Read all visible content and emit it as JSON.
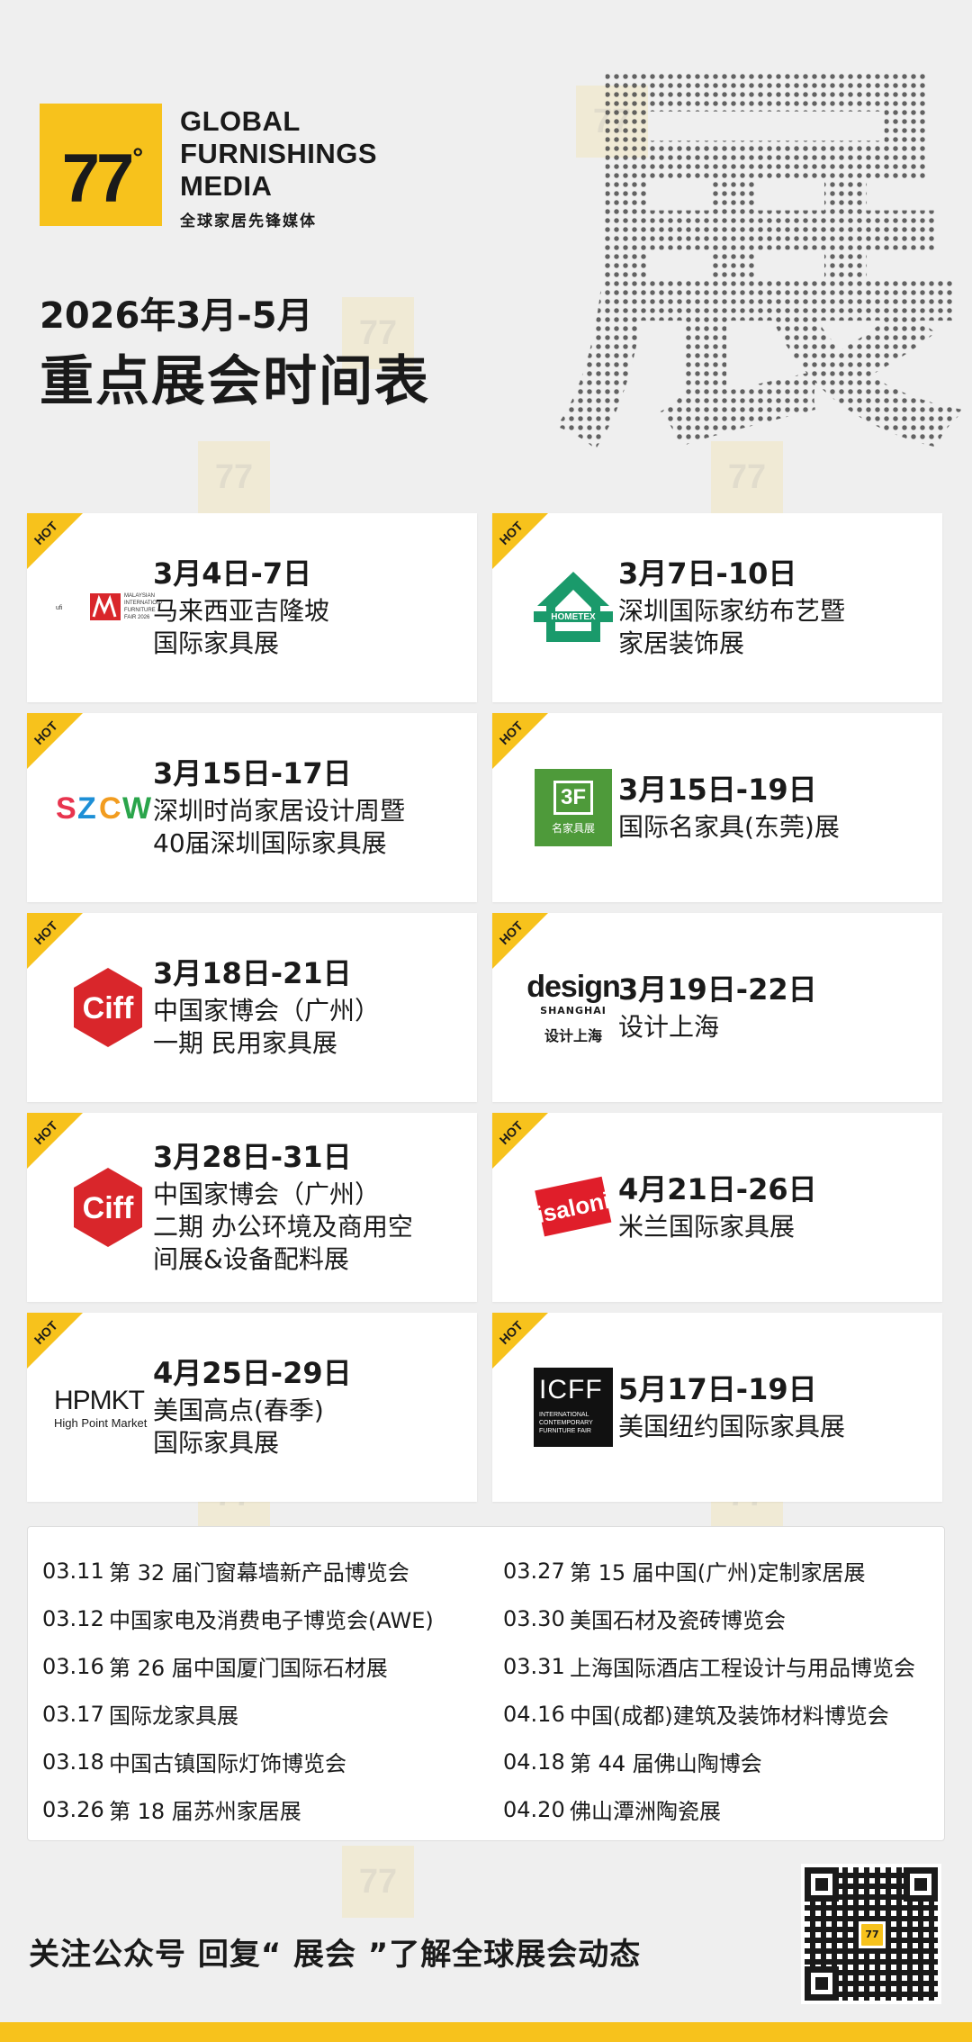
{
  "brand": {
    "logo_number": "77",
    "logo_degree": "°",
    "name_lines": [
      "GLOBAL",
      "FURNISHINGS",
      "MEDIA"
    ],
    "tagline": "全球家居先锋媒体",
    "accent_color": "#f7c21c"
  },
  "background_character": "展",
  "headline": {
    "date_range": "2026年3月-5月",
    "title": "重点展会时间表"
  },
  "hot_label": "HOT",
  "featured": [
    {
      "date": "3月4日-7日",
      "name_lines": [
        "马来西亚吉隆坡",
        "国际家具展"
      ],
      "logo": "miff-logo",
      "logo_text": "MALAYSIAN INTERNATIONAL FURNITURE FAIR 2026"
    },
    {
      "date": "3月7日-10日",
      "name_lines": [
        "深圳国际家纺布艺暨",
        "家居装饰展"
      ],
      "logo": "hometex-logo",
      "logo_text": "HOMETEX"
    },
    {
      "date": "3月15日-17日",
      "name_lines": [
        "深圳时尚家居设计周暨",
        "40届深圳国际家具展"
      ],
      "logo": "szcw-logo",
      "logo_text": "SZCW"
    },
    {
      "date": "3月15日-19日",
      "name_lines": [
        "国际名家具(东莞)展"
      ],
      "logo": "3f-logo",
      "logo_text": "3F",
      "logo_subtext": "名家具展"
    },
    {
      "date": "3月18日-21日",
      "name_lines": [
        "中国家博会（广州）",
        "一期 民用家具展"
      ],
      "logo": "ciff-logo",
      "logo_text": "CIFF"
    },
    {
      "date": "3月19日-22日",
      "name_lines": [
        "设计上海"
      ],
      "logo": "design-shanghai-logo",
      "logo_text": "design",
      "logo_subtext": "SHANGHAI",
      "logo_cn": "设计上海"
    },
    {
      "date": "3月28日-31日",
      "name_lines": [
        "中国家博会（广州）",
        "二期 办公环境及商用空",
        "间展&设备配料展"
      ],
      "logo": "ciff-logo",
      "logo_text": "CIFF"
    },
    {
      "date": "4月21日-26日",
      "name_lines": [
        "米兰国际家具展"
      ],
      "logo": "isaloni-logo",
      "logo_text": "isaloni"
    },
    {
      "date": "4月25日-29日",
      "name_lines": [
        "美国高点(春季)",
        "国际家具展"
      ],
      "logo": "hpmkt-logo",
      "logo_text": "HPMKT",
      "logo_subtext": "High Point Market"
    },
    {
      "date": "5月17日-19日",
      "name_lines": [
        "美国纽约国际家具展"
      ],
      "logo": "icff-logo",
      "logo_text": "ICFF",
      "logo_subtext": "INTERNATIONAL CONTEMPORARY FURNITURE FAIR"
    }
  ],
  "other_events": {
    "left": [
      {
        "date": "03.11",
        "name": "第 32 届门窗幕墙新产品博览会"
      },
      {
        "date": "03.12",
        "name": "中国家电及消费电子博览会(AWE)"
      },
      {
        "date": "03.16",
        "name": "第 26 届中国厦门国际石材展"
      },
      {
        "date": "03.17",
        "name": "国际龙家具展"
      },
      {
        "date": "03.18",
        "name": "中国古镇国际灯饰博览会"
      },
      {
        "date": "03.26",
        "name": "第 18 届苏州家居展"
      }
    ],
    "right": [
      {
        "date": "03.27",
        "name": "第 15 届中国(广州)定制家居展"
      },
      {
        "date": "03.30",
        "name": "美国石材及瓷砖博览会"
      },
      {
        "date": "03.31",
        "name": "上海国际酒店工程设计与用品博览会"
      },
      {
        "date": "04.16",
        "name": "中国(成都)建筑及装饰材料博览会"
      },
      {
        "date": "04.18",
        "name": "第 44 届佛山陶博会"
      },
      {
        "date": "04.20",
        "name": "佛山潭洲陶瓷展"
      }
    ]
  },
  "footer": {
    "text": "关注公众号  回复“ 展会 ”了解全球展会动态",
    "qr_label": "77"
  }
}
